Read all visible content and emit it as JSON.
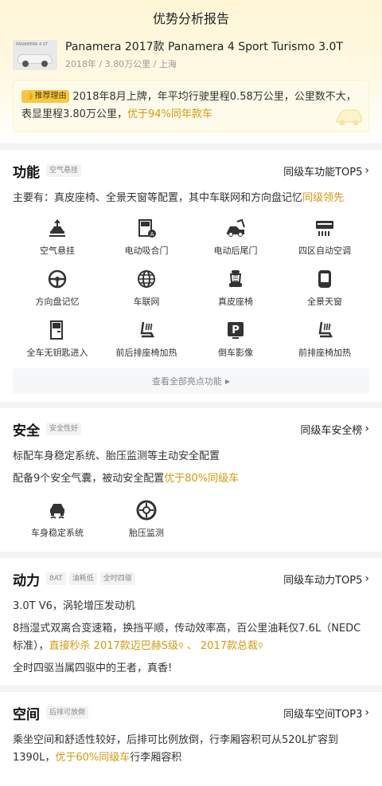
{
  "header": {
    "title": "优势分析报告"
  },
  "car": {
    "title": "Panamera 2017款 Panamera 4 Sport Turismo 3.0T",
    "meta": "2018年 / 3.80万公里 / 上海",
    "thumb_tag": "PANAMERA 4 ST"
  },
  "reason": {
    "badge": "推荐理由",
    "text": "2018年8月上牌，年平均行驶里程0.58万公里，公里数不大，表显里程3.80万公里，",
    "highlight": "优于94%同年款车"
  },
  "function_section": {
    "title": "功能",
    "chip": "空气悬挂",
    "link": "同级车功能TOP5",
    "summary": "主要有：真皮座椅、全景天窗等配置，其中车联网和方向盘记忆",
    "summary_highlight": "同级领先",
    "features": [
      {
        "label": "空气悬挂",
        "icon": "air-suspension-icon"
      },
      {
        "label": "电动吸合门",
        "icon": "soft-close-door-icon"
      },
      {
        "label": "电动后尾门",
        "icon": "power-tailgate-icon"
      },
      {
        "label": "四区自动空调",
        "icon": "four-zone-ac-icon"
      },
      {
        "label": "方向盘记忆",
        "icon": "steering-memory-icon"
      },
      {
        "label": "车联网",
        "icon": "connected-car-icon"
      },
      {
        "label": "真皮座椅",
        "icon": "leather-seat-icon"
      },
      {
        "label": "全景天窗",
        "icon": "panoramic-sunroof-icon"
      },
      {
        "label": "全车无钥匙进入",
        "icon": "keyless-entry-icon"
      },
      {
        "label": "前后排座椅加热",
        "icon": "seat-heating-icon"
      },
      {
        "label": "倒车影像",
        "icon": "reverse-camera-icon"
      },
      {
        "label": "前排座椅加热",
        "icon": "front-seat-heating-icon"
      }
    ],
    "view_all": "查看全部亮点功能"
  },
  "safety_section": {
    "title": "安全",
    "chip": "安全性好",
    "link": "同级车安全榜",
    "line1": "标配车身稳定系统、胎压监测等主动安全配置",
    "line2": "配备9个安全气囊，被动安全配置",
    "line2_highlight": "优于80%同级车",
    "features": [
      {
        "label": "车身稳定系统",
        "icon": "stability-control-icon"
      },
      {
        "label": "胎压监测",
        "icon": "tire-pressure-icon"
      }
    ]
  },
  "power_section": {
    "title": "动力",
    "chips": [
      "8AT",
      "油耗低",
      "全时四驱"
    ],
    "link": "同级车动力TOP5",
    "line1": "3.0T V6，涡轮增压发动机",
    "line2": "8挡湿式双离合变速箱，换挡平顺，传动效率高，百公里油耗仅7.6L（NEDC标准），",
    "kill_prefix": "直接秒杀",
    "compare1": "2017款迈巴赫S级",
    "sep": "、",
    "compare2": "2017款总裁",
    "line3": "全时四驱当属四驱中的王者，真香!"
  },
  "space_section": {
    "title": "空间",
    "chip": "后排可放倒",
    "link": "同级车空间TOP3",
    "text": "乘坐空间和舒适性较好，后排可比例放倒，行李厢容积可从520L扩容到1390L，",
    "highlight": "优于60%同级车",
    "text_tail": "行李厢容积"
  },
  "colors": {
    "accent": "#d49a10",
    "badge": "#f6c945"
  }
}
